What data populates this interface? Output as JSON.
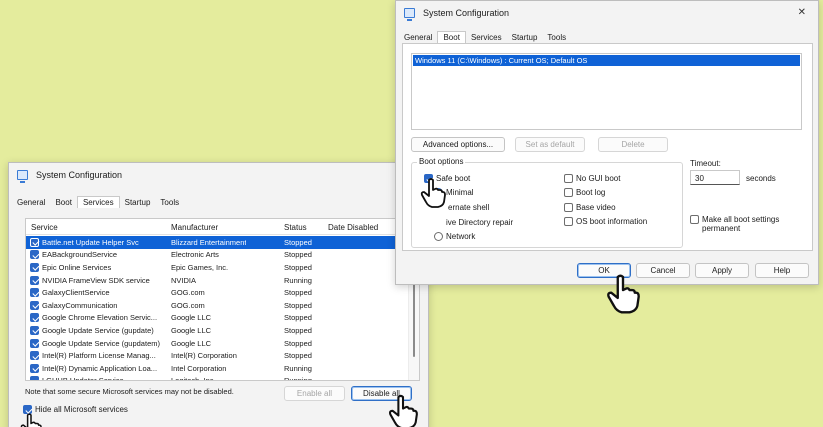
{
  "win_left": {
    "title": "System Configuration",
    "tabs": [
      "General",
      "Boot",
      "Services",
      "Startup",
      "Tools"
    ],
    "active_tab": "Services",
    "columns": [
      "Service",
      "Manufacturer",
      "Status",
      "Date Disabled"
    ],
    "rows": [
      {
        "service": "Battle.net Update Helper Svc",
        "manufacturer": "Blizzard Entertainment",
        "status": "Stopped",
        "selected": true
      },
      {
        "service": "EABackgroundService",
        "manufacturer": "Electronic Arts",
        "status": "Stopped"
      },
      {
        "service": "Epic Online Services",
        "manufacturer": "Epic Games, Inc.",
        "status": "Stopped"
      },
      {
        "service": "NVIDIA FrameView SDK service",
        "manufacturer": "NVIDIA",
        "status": "Running"
      },
      {
        "service": "GalaxyClientService",
        "manufacturer": "GOG.com",
        "status": "Stopped"
      },
      {
        "service": "GalaxyCommunication",
        "manufacturer": "GOG.com",
        "status": "Stopped"
      },
      {
        "service": "Google Chrome Elevation Servic...",
        "manufacturer": "Google LLC",
        "status": "Stopped"
      },
      {
        "service": "Google Update Service (gupdate)",
        "manufacturer": "Google LLC",
        "status": "Stopped"
      },
      {
        "service": "Google Update Service (gupdatem)",
        "manufacturer": "Google LLC",
        "status": "Stopped"
      },
      {
        "service": "Intel(R) Platform License Manag...",
        "manufacturer": "Intel(R) Corporation",
        "status": "Stopped"
      },
      {
        "service": "Intel(R) Dynamic Application Loa...",
        "manufacturer": "Intel Corporation",
        "status": "Running"
      },
      {
        "service": "LGHUB Updater Service",
        "manufacturer": "Logitech, Inc.",
        "status": "Running"
      }
    ],
    "note": "Note that some secure Microsoft services may not be disabled.",
    "enable_all": "Enable all",
    "disable_all": "Disable all",
    "hide_ms": "Hide all Microsoft services"
  },
  "win_right": {
    "title": "System Configuration",
    "close": "✕",
    "tabs": [
      "General",
      "Boot",
      "Services",
      "Startup",
      "Tools"
    ],
    "active_tab": "Boot",
    "os_entry": "Windows 11 (C:\\Windows) : Current OS; Default OS",
    "advanced_options": "Advanced options...",
    "set_default": "Set as default",
    "delete": "Delete",
    "boot_options_label": "Boot options",
    "safe_boot": "Safe boot",
    "minimal": "Minimal",
    "alternate_shell": "ernate shell",
    "ad_repair": "ive Directory repair",
    "network": "Network",
    "no_gui_boot": "No GUI boot",
    "boot_log": "Boot log",
    "base_video": "Base video",
    "os_boot_info": "OS boot information",
    "timeout_label": "Timeout:",
    "timeout_value": "30",
    "seconds": "seconds",
    "make_permanent": "Make all boot settings permanent",
    "ok": "OK",
    "cancel": "Cancel",
    "apply": "Apply",
    "help": "Help"
  }
}
